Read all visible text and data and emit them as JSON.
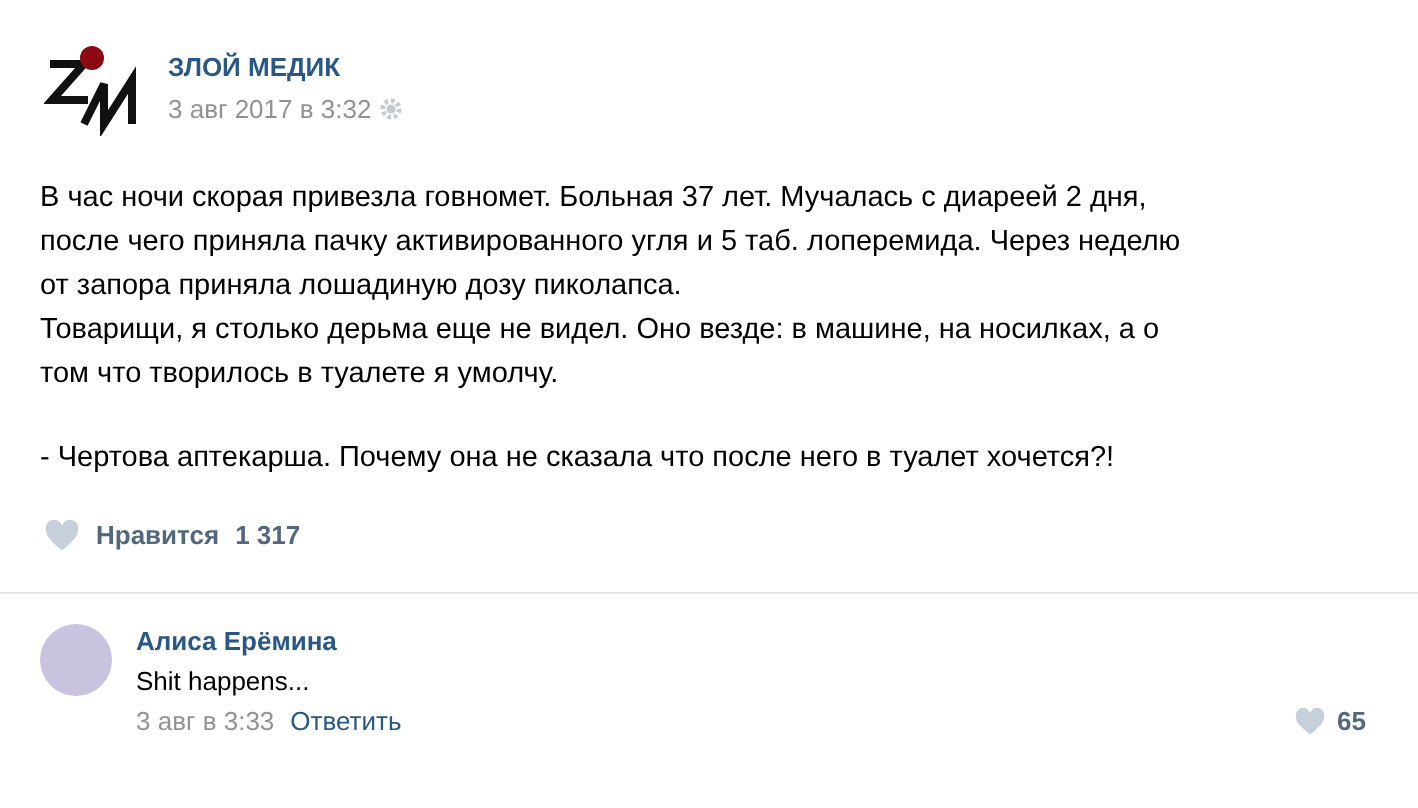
{
  "post": {
    "author": "ЗЛОЙ МЕДИК",
    "date": "3 авг 2017 в 3:32",
    "paragraphs": [
      [
        "В час ночи скорая привезла говномет. Больная 37 лет. Мучалась с диареей 2 дня,",
        "после чего приняла пачку активированного угля и 5 таб. лоперемида. Через неделю",
        "от запора приняла лошадиную дозу пиколапса.",
        "Товарищи, я столько дерьма еще не видел. Оно везде: в машине, на носилках, а о",
        "том что творилось в туалете я умолчу."
      ],
      [
        "- Чертова аптекарша. Почему она не сказала что после него в туалет хочется?!"
      ]
    ],
    "like": {
      "label": "Нравится",
      "count": "1 317",
      "liked": false
    }
  },
  "comment": {
    "author": "Алиса Ерёмина",
    "text": "Shit happens...",
    "date": "3 авг в 3:33",
    "reply": "Ответить",
    "likes": "65",
    "liked": false
  }
}
